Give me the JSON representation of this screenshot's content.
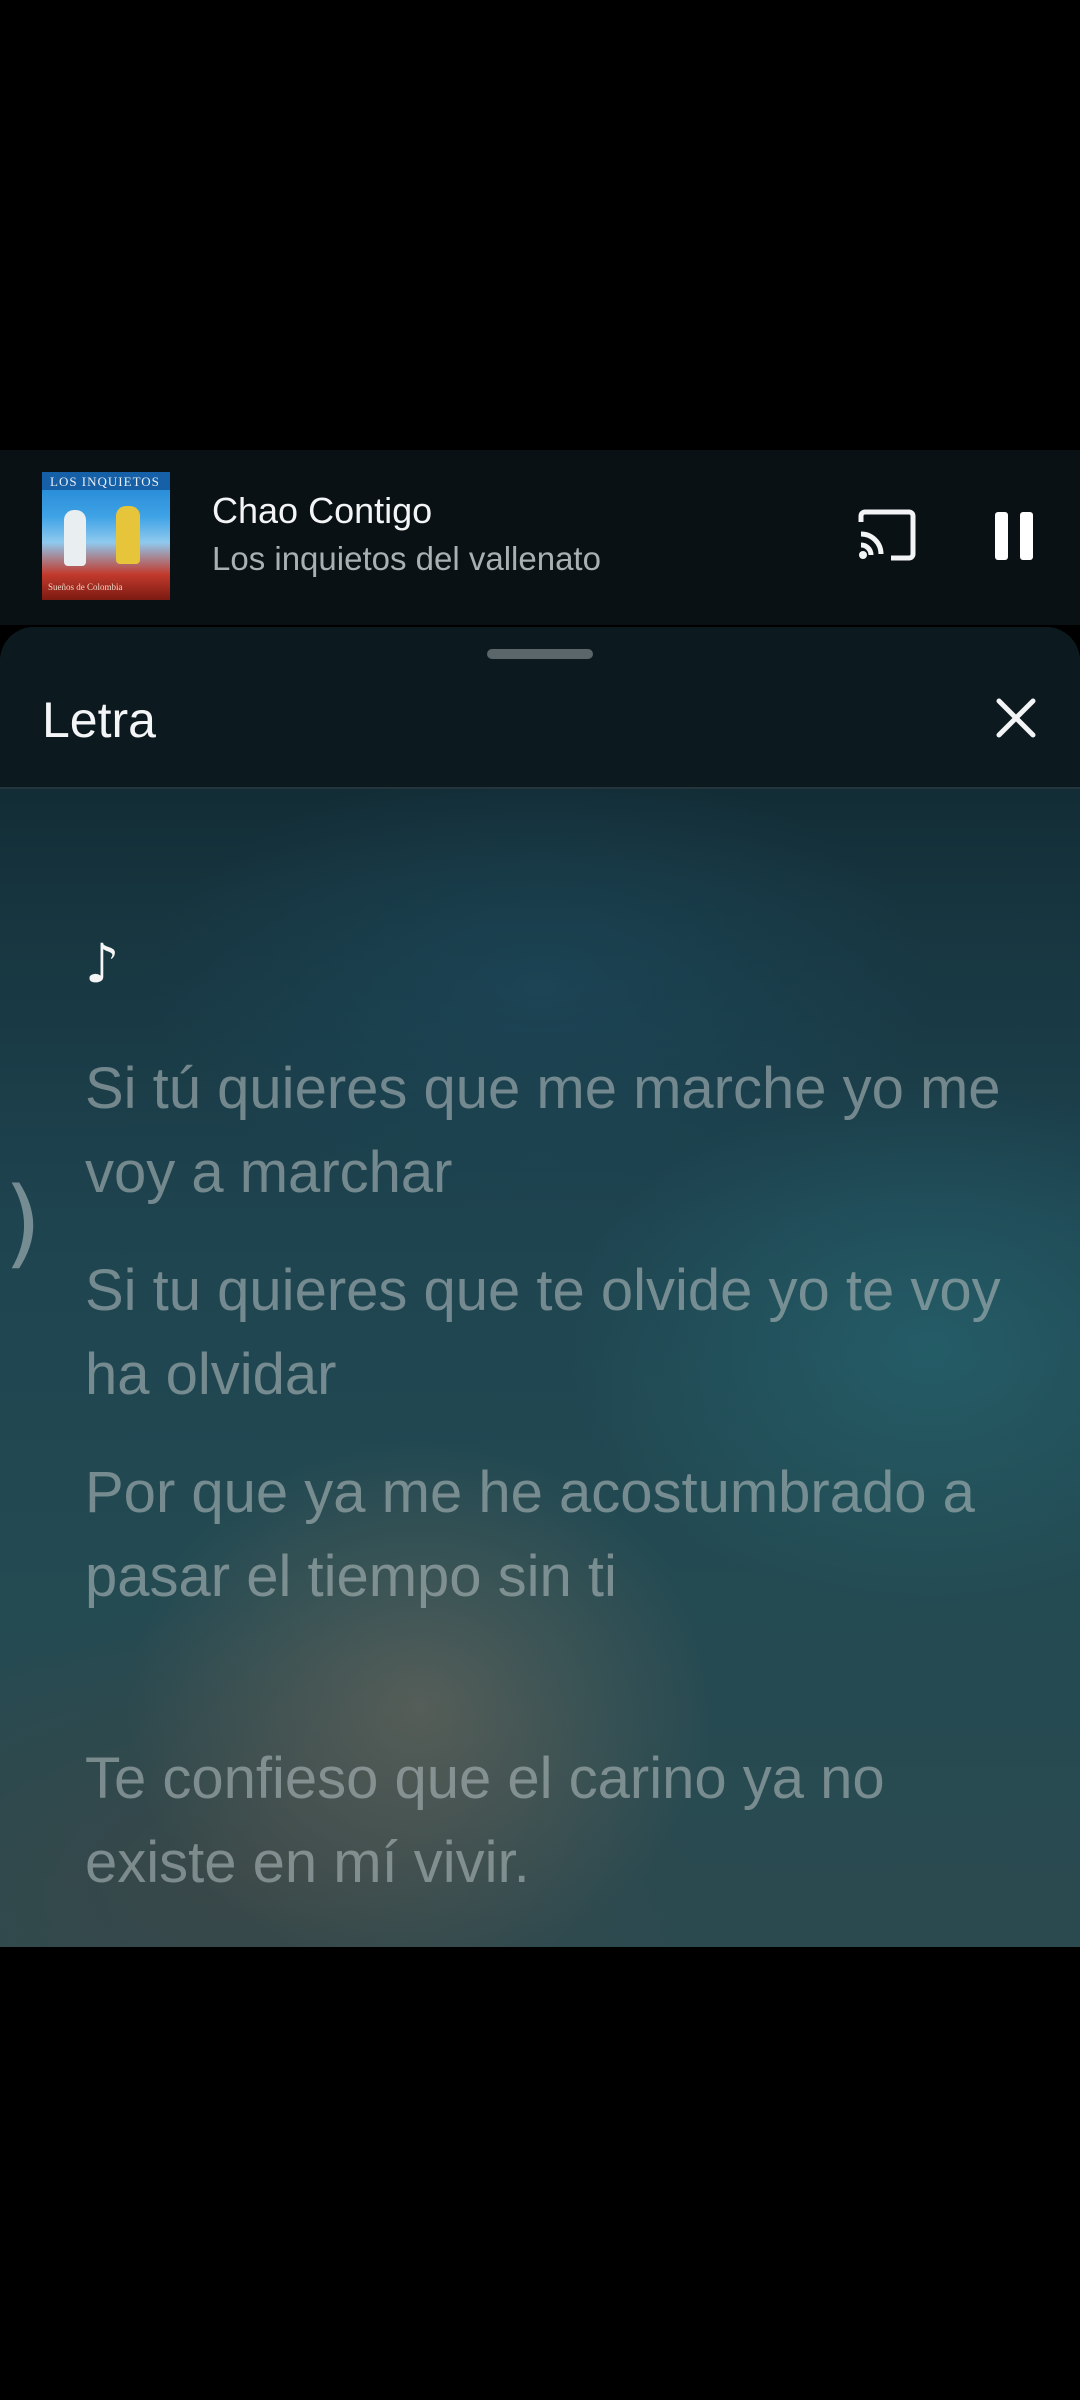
{
  "mini_player": {
    "album_art": {
      "cover_text": "LOS INQUIETOS",
      "cover_subtitle": "Sueños de Colombia"
    },
    "title": "Chao Contigo",
    "artist": "Los inquietos del vallenato",
    "cast_icon": "cast-icon",
    "pause_icon": "pause-icon"
  },
  "lyrics_sheet": {
    "title": "Letra",
    "close_icon": "close-icon",
    "intro_symbol": "♪",
    "side_mark": ")",
    "lines": [
      "Si tú quieres que me marche yo me voy a marchar",
      "Si tu quieres que te olvide yo te voy ha olvidar",
      "Por que ya me he acostumbrado a pasar el tiempo sin ti",
      "Te confieso que el carino ya no existe en mí vivir."
    ]
  },
  "colors": {
    "background": "#000000",
    "player_bar": "#0a1114",
    "sheet_header": "#0c1a1f",
    "lyric_text": "#aab4b6",
    "primary_text": "#f2f4f5"
  }
}
